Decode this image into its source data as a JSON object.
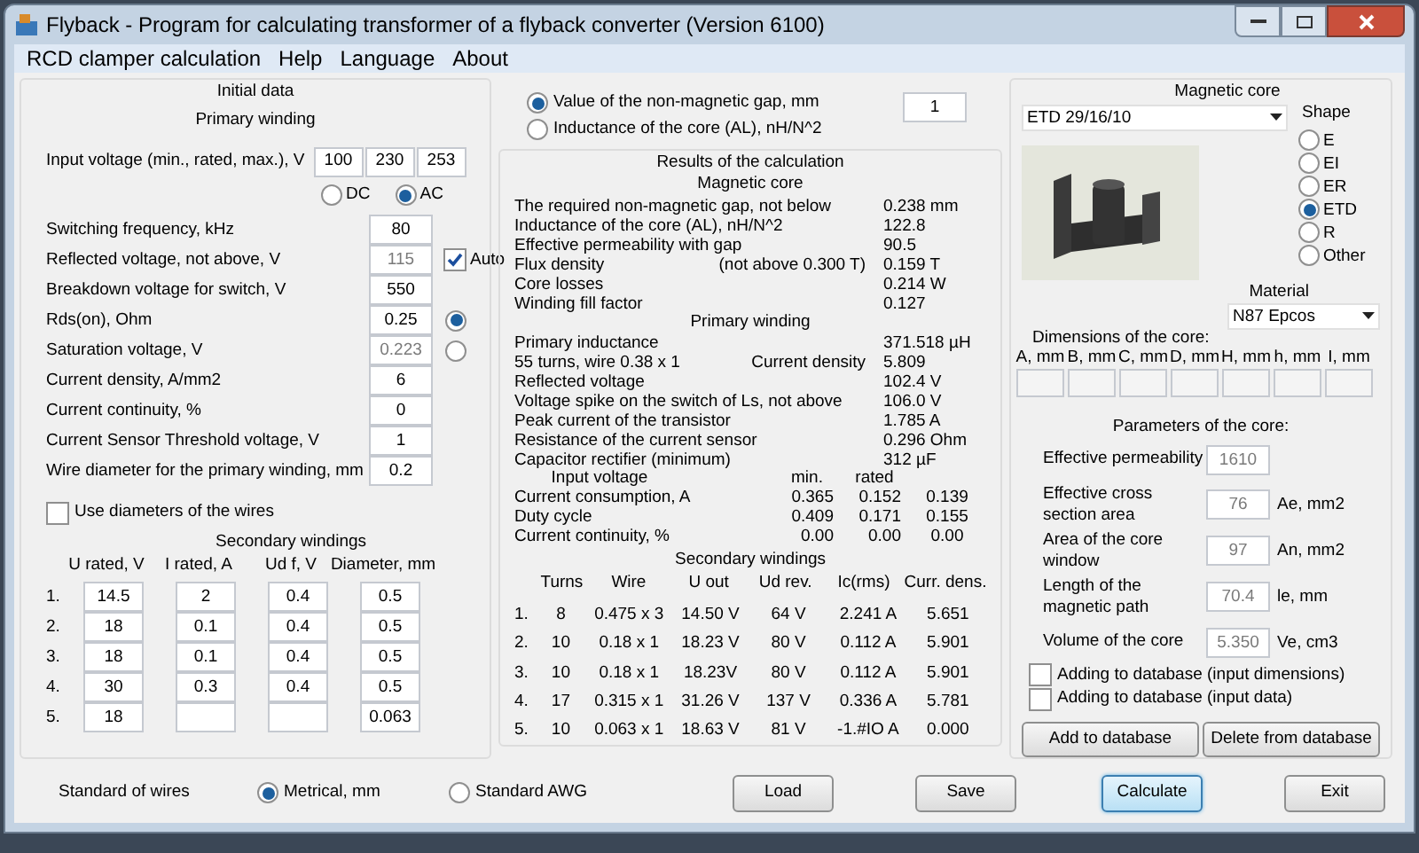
{
  "window": {
    "title": "Flyback - Program for calculating transformer of a flyback converter (Version 6100)"
  },
  "menu": [
    "RCD clamper calculation",
    "Help",
    "Language",
    "About"
  ],
  "initial_data": {
    "title": "Initial data",
    "primary_title": "Primary winding",
    "input_voltage": {
      "label": "Input voltage (min., rated, max.), V",
      "values": [
        "100",
        "230",
        "253"
      ]
    },
    "source": [
      {
        "label": "DC",
        "selected": false
      },
      {
        "label": "AC",
        "selected": true
      }
    ],
    "params": [
      {
        "kind": "plain",
        "label": "Switching frequency, kHz",
        "value": "80",
        "disabled": false
      },
      {
        "kind": "auto",
        "label": "Reflected voltage, not above, V",
        "value": "115",
        "disabled": true,
        "auto_label": "Auto",
        "auto_checked": true
      },
      {
        "kind": "plain",
        "label": "Breakdown voltage for switch, V",
        "value": "550",
        "disabled": false
      },
      {
        "kind": "radio",
        "label": "Rds(on), Ohm",
        "value": "0.25",
        "disabled": false,
        "selected": true
      },
      {
        "kind": "radio",
        "label": "Saturation voltage, V",
        "value": "0.223",
        "disabled": true,
        "selected": false
      },
      {
        "kind": "plain",
        "label": "Current density, A/mm2",
        "value": "6",
        "disabled": false
      },
      {
        "kind": "plain",
        "label": "Current continuity, %",
        "value": "0",
        "disabled": false
      },
      {
        "kind": "plain",
        "label": "Current Sensor Threshold voltage, V",
        "value": "1",
        "disabled": false
      },
      {
        "kind": "plain",
        "label": "Wire diameter for the primary winding, mm",
        "value": "0.2",
        "disabled": false
      }
    ],
    "use_diameters": {
      "label": "Use diameters of the wires",
      "checked": false
    },
    "secondary": {
      "title": "Secondary windings",
      "columns": [
        "U rated, V",
        "I rated, A",
        "Ud f, V",
        "Diameter, mm"
      ],
      "rows": [
        {
          "number": "1.",
          "u_rated": "14.5",
          "i_rated": "2",
          "ud": "0.4",
          "diameter": "0.5"
        },
        {
          "number": "2.",
          "u_rated": "18",
          "i_rated": "0.1",
          "ud": "0.4",
          "diameter": "0.5"
        },
        {
          "number": "3.",
          "u_rated": "18",
          "i_rated": "0.1",
          "ud": "0.4",
          "diameter": "0.5"
        },
        {
          "number": "4.",
          "u_rated": "30",
          "i_rated": "0.3",
          "ud": "0.4",
          "diameter": "0.5"
        },
        {
          "number": "5.",
          "u_rated": "18",
          "diameter": "0.063"
        }
      ]
    }
  },
  "gap_mode": {
    "options": [
      {
        "label": "Value of the non-magnetic gap, mm",
        "selected": true
      },
      {
        "label": "Inductance of the core (AL), nH/N^2",
        "selected": false
      }
    ],
    "value": "1"
  },
  "results": {
    "title": "Results of the calculation",
    "core": {
      "title": "Magnetic core",
      "rows": [
        {
          "label": "The required non-magnetic gap, not below",
          "value": "0.238 mm"
        },
        {
          "label": "Inductance of the core (AL), nH/N^2",
          "value": "122.8"
        },
        {
          "label": "Effective permeability with gap",
          "value": "90.5"
        },
        {
          "label": "Flux density",
          "note": "(not above 0.300 T)",
          "value": "0.159 T"
        },
        {
          "label": "Core losses",
          "value": "0.214 W"
        },
        {
          "label": "Winding fill factor",
          "value": "0.127"
        }
      ]
    },
    "primary": {
      "title": "Primary winding",
      "rows": [
        {
          "label": "Primary inductance",
          "value": "371.518 µH"
        },
        {
          "label": "55 turns, wire 0.38 x 1",
          "note": "Current density",
          "value": "5.809"
        },
        {
          "label": "Reflected voltage",
          "value": "102.4 V"
        },
        {
          "label": "Voltage spike on the switch of Ls, not above",
          "value": "106.0 V"
        },
        {
          "label": "Peak current of the transistor",
          "value": "1.785 A"
        },
        {
          "label": "Resistance of the current sensor",
          "value": "0.296 Ohm"
        },
        {
          "label": "Capacitor rectifier (minimum)",
          "value": "312 µF"
        }
      ]
    },
    "input_table": {
      "title": "Input voltage",
      "columns": [
        "min.",
        "rated"
      ],
      "rows": [
        {
          "label": "Current consumption, A",
          "values": [
            "0.365",
            "0.152",
            "0.139"
          ]
        },
        {
          "label": "Duty cycle",
          "values": [
            "0.409",
            "0.171",
            "0.155"
          ]
        },
        {
          "label": "Current continuity, %",
          "values": [
            "0.00",
            "0.00",
            "0.00"
          ]
        }
      ]
    },
    "secondary": {
      "title": "Secondary windings",
      "columns": [
        "Turns",
        "Wire",
        "U out",
        "Ud rev.",
        "Ic(rms)",
        "Curr. dens."
      ],
      "rows": [
        {
          "number": "1.",
          "values": [
            "8",
            "0.475 x 3",
            "14.50 V",
            "64 V",
            "2.241 A",
            "5.651"
          ]
        },
        {
          "number": "2.",
          "values": [
            "10",
            "0.18 x 1",
            "18.23 V",
            "80 V",
            "0.112 A",
            "5.901"
          ]
        },
        {
          "number": "3.",
          "values": [
            "10",
            "0.18 x 1",
            "18.23V",
            "80 V",
            "0.112 A",
            "5.901"
          ]
        },
        {
          "number": "4.",
          "values": [
            "17",
            "0.315 x 1",
            "31.26 V",
            "137 V",
            "0.336 A",
            "5.781"
          ]
        },
        {
          "number": "5.",
          "values": [
            "10",
            "0.063 x 1",
            "18.63 V",
            "81 V",
            "-1.#IO A",
            "0.000"
          ]
        }
      ]
    }
  },
  "magnetic_core": {
    "title": "Magnetic core",
    "core": "ETD 29/16/10",
    "shape_title": "Shape",
    "shapes": [
      {
        "label": "E",
        "selected": false
      },
      {
        "label": "EI",
        "selected": false
      },
      {
        "label": "ER",
        "selected": false
      },
      {
        "label": "ETD",
        "selected": true
      },
      {
        "label": "R",
        "selected": false
      },
      {
        "label": "Other",
        "selected": false
      }
    ],
    "material_title": "Material",
    "material": "N87 Epcos",
    "dimensions_title": "Dimensions of the core:",
    "dimension_columns": [
      "A, mm",
      "B, mm",
      "C, mm",
      "D, mm",
      "H, mm",
      "h, mm",
      "I, mm"
    ],
    "parameters_title": "Parameters of the core:",
    "parameters": [
      {
        "label": "Effective permeability",
        "value": "1610"
      },
      {
        "label": "Effective cross section area",
        "value": "76",
        "unit": "Ae, mm2"
      },
      {
        "label": "Area of the core window",
        "value": "97",
        "unit": "An, mm2"
      },
      {
        "label": "Length of the magnetic path",
        "value": "70.4",
        "unit": "le, mm"
      },
      {
        "label": "Volume of the core",
        "value": "5.350",
        "unit": "Ve, cm3"
      }
    ],
    "checkboxes": [
      {
        "label": "Adding to database (input dimensions)",
        "checked": false
      },
      {
        "label": "Adding to database (input data)",
        "checked": false
      }
    ],
    "buttons": [
      "Add to database",
      "Delete from database"
    ]
  },
  "wire_standard": {
    "label": "Standard of wires",
    "options": [
      {
        "label": "Metrical, mm",
        "selected": true
      },
      {
        "label": "Standard AWG",
        "selected": false
      }
    ]
  },
  "buttons": [
    {
      "label": "Load",
      "focused": false
    },
    {
      "label": "Save",
      "focused": false
    },
    {
      "label": "Calculate",
      "focused": true
    },
    {
      "label": "Exit",
      "focused": false
    }
  ]
}
